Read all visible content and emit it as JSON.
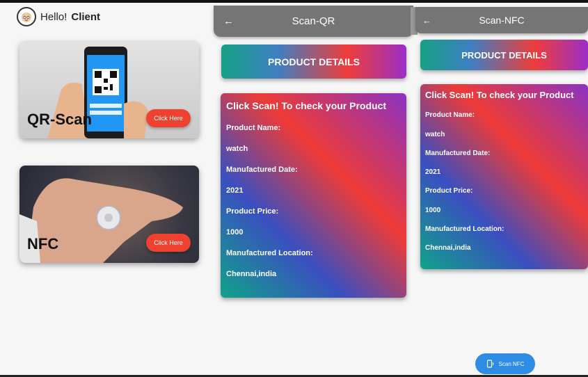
{
  "home": {
    "greeting": "Hello!",
    "user": "Client",
    "qr_card": {
      "label": "QR-Scan",
      "button": "Click Here"
    },
    "nfc_card": {
      "label": "NFC",
      "button": "Click Here"
    }
  },
  "scan_qr": {
    "title": "Scan-QR",
    "banner": "PRODUCT DETAILS",
    "heading": "Click Scan! To check your Product",
    "fields": [
      {
        "label": "Product Name:",
        "value": "watch"
      },
      {
        "label": "Manufactured Date:",
        "value": "2021"
      },
      {
        "label": "Product Price:",
        "value": "1000"
      },
      {
        "label": "Manufactured Location:",
        "value": "Chennai,india"
      }
    ]
  },
  "scan_nfc": {
    "title": "Scan-NFC",
    "banner": "PRODUCT DETAILS",
    "heading": "Click Scan! To check your Product",
    "fields": [
      {
        "label": "Product Name:",
        "value": "watch"
      },
      {
        "label": "Manufactured Date:",
        "value": "2021"
      },
      {
        "label": "Product Price:",
        "value": "1000"
      },
      {
        "label": "Manufactured Location:",
        "value": "Chennai,india"
      }
    ],
    "fab_label": "Scan NFC"
  },
  "colors": {
    "accent_red": "#ef4130",
    "fab_blue": "#2f8ce5",
    "appbar_gray": "#757575"
  }
}
